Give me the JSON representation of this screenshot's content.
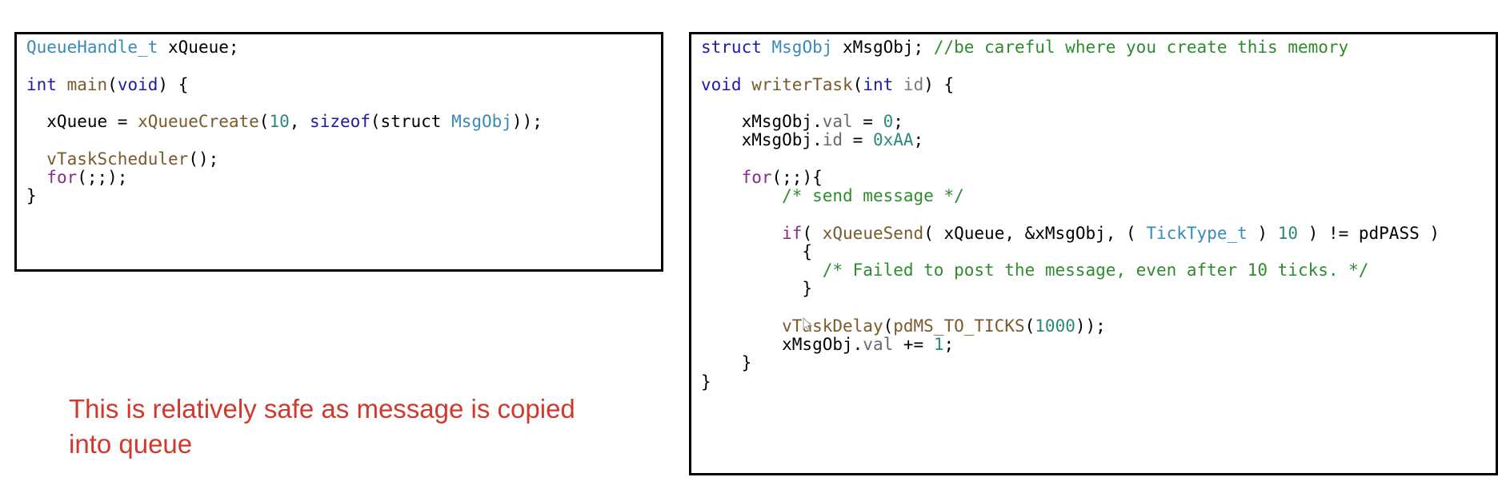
{
  "left_code": {
    "lines": [
      [
        {
          "t": "QueueHandle_t",
          "c": "type"
        },
        {
          "t": " xQueue;",
          "c": "plain"
        }
      ],
      [],
      [
        {
          "t": "int",
          "c": "kw"
        },
        {
          "t": " ",
          "c": "plain"
        },
        {
          "t": "main",
          "c": "func"
        },
        {
          "t": "(",
          "c": "plain"
        },
        {
          "t": "void",
          "c": "kw"
        },
        {
          "t": ") {",
          "c": "plain"
        }
      ],
      [],
      [
        {
          "t": "  xQueue = ",
          "c": "plain"
        },
        {
          "t": "xQueueCreate",
          "c": "func"
        },
        {
          "t": "(",
          "c": "plain"
        },
        {
          "t": "10",
          "c": "num"
        },
        {
          "t": ", ",
          "c": "plain"
        },
        {
          "t": "sizeof",
          "c": "kw"
        },
        {
          "t": "(struct ",
          "c": "plain"
        },
        {
          "t": "MsgObj",
          "c": "type"
        },
        {
          "t": "));",
          "c": "plain"
        }
      ],
      [],
      [
        {
          "t": "  ",
          "c": "plain"
        },
        {
          "t": "vTaskScheduler",
          "c": "func"
        },
        {
          "t": "();",
          "c": "plain"
        }
      ],
      [
        {
          "t": "  ",
          "c": "plain"
        },
        {
          "t": "for",
          "c": "flow"
        },
        {
          "t": "(;;);",
          "c": "plain"
        }
      ],
      [
        {
          "t": "}",
          "c": "plain"
        }
      ]
    ]
  },
  "right_code": {
    "lines": [
      [
        {
          "t": "struct",
          "c": "kw"
        },
        {
          "t": " ",
          "c": "plain"
        },
        {
          "t": "MsgObj",
          "c": "type"
        },
        {
          "t": " xMsgObj; ",
          "c": "plain"
        },
        {
          "t": "//be careful where you create this memory",
          "c": "comment"
        }
      ],
      [],
      [
        {
          "t": "void",
          "c": "kw"
        },
        {
          "t": " ",
          "c": "plain"
        },
        {
          "t": "writerTask",
          "c": "func"
        },
        {
          "t": "(",
          "c": "plain"
        },
        {
          "t": "int",
          "c": "kw"
        },
        {
          "t": " ",
          "c": "plain"
        },
        {
          "t": "id",
          "c": "param"
        },
        {
          "t": ") {",
          "c": "plain"
        }
      ],
      [],
      [
        {
          "t": "    xMsgObj.",
          "c": "plain"
        },
        {
          "t": "val",
          "c": "member"
        },
        {
          "t": " = ",
          "c": "plain"
        },
        {
          "t": "0",
          "c": "num"
        },
        {
          "t": ";",
          "c": "plain"
        }
      ],
      [
        {
          "t": "    xMsgObj.",
          "c": "plain"
        },
        {
          "t": "id",
          "c": "member"
        },
        {
          "t": " = ",
          "c": "plain"
        },
        {
          "t": "0xAA",
          "c": "num"
        },
        {
          "t": ";",
          "c": "plain"
        }
      ],
      [],
      [
        {
          "t": "    ",
          "c": "plain"
        },
        {
          "t": "for",
          "c": "flow"
        },
        {
          "t": "(;;){",
          "c": "plain"
        }
      ],
      [
        {
          "t": "        ",
          "c": "plain"
        },
        {
          "t": "/* send message */",
          "c": "comment"
        }
      ],
      [],
      [
        {
          "t": "        ",
          "c": "plain"
        },
        {
          "t": "if",
          "c": "flow"
        },
        {
          "t": "( ",
          "c": "plain"
        },
        {
          "t": "xQueueSend",
          "c": "func"
        },
        {
          "t": "( xQueue, &xMsgObj, ( ",
          "c": "plain"
        },
        {
          "t": "TickType_t",
          "c": "type"
        },
        {
          "t": " ) ",
          "c": "plain"
        },
        {
          "t": "10",
          "c": "num"
        },
        {
          "t": " ) != pdPASS )",
          "c": "plain"
        }
      ],
      [
        {
          "t": "          {",
          "c": "plain"
        }
      ],
      [
        {
          "t": "            ",
          "c": "plain"
        },
        {
          "t": "/* Failed to post the message, even after 10 ticks. */",
          "c": "comment"
        }
      ],
      [
        {
          "t": "          }",
          "c": "plain"
        }
      ],
      [],
      [
        {
          "t": "        ",
          "c": "plain"
        },
        {
          "t": "vTaskDelay",
          "c": "func"
        },
        {
          "t": "(",
          "c": "plain"
        },
        {
          "t": "pdMS_TO_TICKS",
          "c": "func"
        },
        {
          "t": "(",
          "c": "plain"
        },
        {
          "t": "1000",
          "c": "num"
        },
        {
          "t": "));",
          "c": "plain"
        }
      ],
      [
        {
          "t": "        xMsgObj.",
          "c": "plain"
        },
        {
          "t": "val",
          "c": "member"
        },
        {
          "t": " += ",
          "c": "plain"
        },
        {
          "t": "1",
          "c": "num"
        },
        {
          "t": ";",
          "c": "plain"
        }
      ],
      [
        {
          "t": "    }",
          "c": "plain"
        }
      ],
      [
        {
          "t": "}",
          "c": "plain"
        }
      ]
    ]
  },
  "note": {
    "text": "This is relatively safe as message is copied into queue"
  },
  "colors": {
    "type": "#3a8ab8",
    "keyword": "#1d1ba8",
    "function": "#7a5a2a",
    "number": "#2a8a7a",
    "comment": "#2e8b2e",
    "flow": "#8a2a8a",
    "note": "#d2382b"
  },
  "icons": {
    "cursor": "mouse-pointer-icon"
  }
}
